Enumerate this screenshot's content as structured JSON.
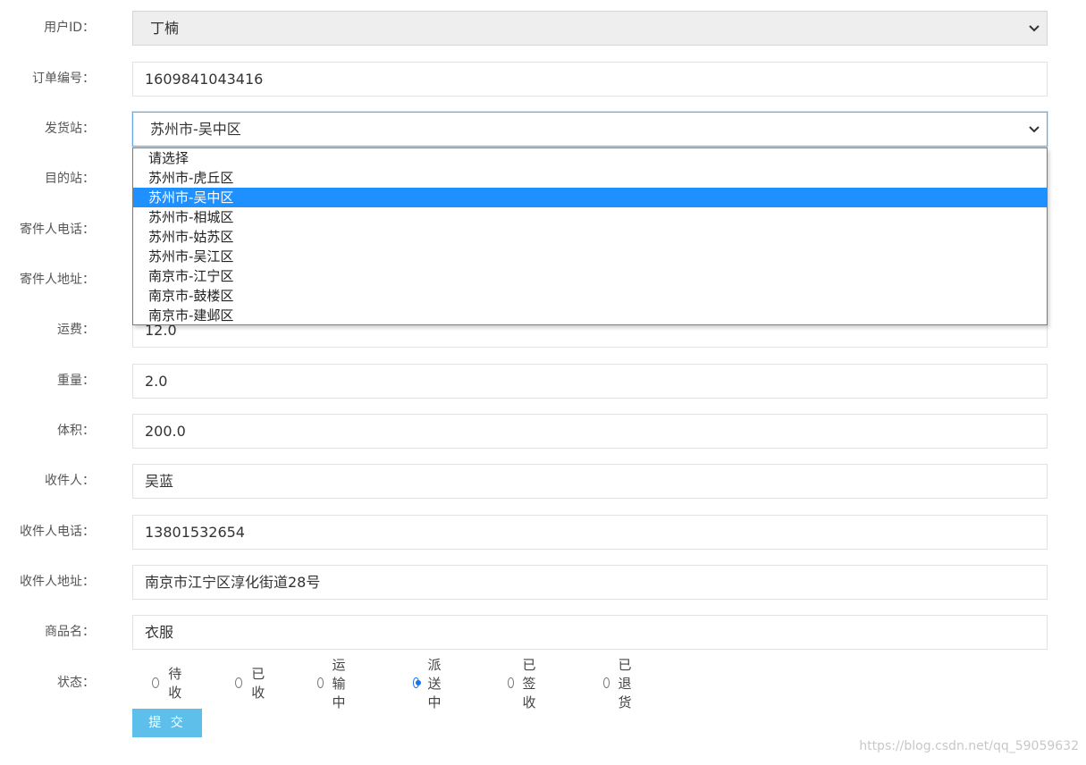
{
  "form": {
    "fields": {
      "user_id": {
        "label": "用户ID：",
        "value": "丁楠"
      },
      "order_no": {
        "label": "订单编号：",
        "value": "1609841043416"
      },
      "origin": {
        "label": "发货站：",
        "value": "苏州市-吴中区"
      },
      "destination": {
        "label": "目的站："
      },
      "sender_phone": {
        "label": "寄件人电话："
      },
      "sender_addr": {
        "label": "寄件人地址："
      },
      "freight": {
        "label": "运费：",
        "value": "12.0"
      },
      "weight": {
        "label": "重量：",
        "value": "2.0"
      },
      "volume": {
        "label": "体积：",
        "value": "200.0"
      },
      "receiver": {
        "label": "收件人：",
        "value": "吴蓝"
      },
      "receiver_phone": {
        "label": "收件人电话：",
        "value": "13801532654"
      },
      "receiver_addr": {
        "label": "收件人地址：",
        "value": "南京市江宁区淳化街道28号"
      },
      "goods": {
        "label": "商品名：",
        "value": "衣服"
      },
      "status": {
        "label": "状态："
      }
    },
    "origin_options": [
      "请选择",
      "苏州市-虎丘区",
      "苏州市-吴中区",
      "苏州市-相城区",
      "苏州市-姑苏区",
      "苏州市-吴江区",
      "南京市-江宁区",
      "南京市-鼓楼区",
      "南京市-建邺区"
    ],
    "selected_origin_index": 2,
    "status_options": [
      "待收",
      "已收",
      "运输中",
      "派送中",
      "已签收",
      "已退货"
    ],
    "selected_status": "派送中",
    "submit_label": "提 交"
  },
  "watermark": "https://blog.csdn.net/qq_59059632",
  "colors": {
    "accent": "#1e90ff",
    "submit": "#5ec0ea"
  }
}
